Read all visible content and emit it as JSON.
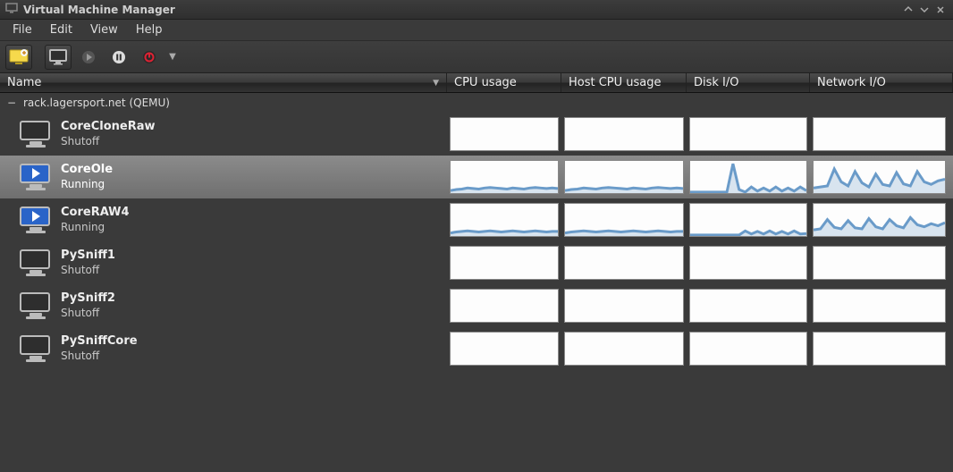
{
  "window": {
    "title": "Virtual Machine Manager"
  },
  "menu": {
    "file": "File",
    "edit": "Edit",
    "view": "View",
    "help": "Help"
  },
  "columns": {
    "name": "Name",
    "cpu": "CPU usage",
    "host": "Host CPU usage",
    "disk": "Disk I/O",
    "net": "Network I/O"
  },
  "host": {
    "label": "rack.lagersport.net (QEMU)"
  },
  "status": {
    "shutoff": "Shutoff",
    "running": "Running"
  },
  "vms": [
    {
      "name": "CoreCloneRaw",
      "status": "shutoff",
      "selected": false,
      "cpu": [
        0,
        0,
        0,
        0,
        0,
        0,
        0,
        0,
        0,
        0,
        0,
        0,
        0,
        0,
        0,
        0,
        0,
        0,
        0,
        0
      ],
      "hostcpu": [
        0,
        0,
        0,
        0,
        0,
        0,
        0,
        0,
        0,
        0,
        0,
        0,
        0,
        0,
        0,
        0,
        0,
        0,
        0,
        0
      ],
      "disk": [
        0,
        0,
        0,
        0,
        0,
        0,
        0,
        0,
        0,
        0,
        0,
        0,
        0,
        0,
        0,
        0,
        0,
        0,
        0,
        0
      ],
      "net": [
        0,
        0,
        0,
        0,
        0,
        0,
        0,
        0,
        0,
        0,
        0,
        0,
        0,
        0,
        0,
        0,
        0,
        0,
        0,
        0
      ]
    },
    {
      "name": "CoreOle",
      "status": "running",
      "selected": true,
      "cpu": [
        3,
        5,
        6,
        8,
        7,
        6,
        8,
        9,
        8,
        7,
        6,
        8,
        7,
        6,
        8,
        9,
        8,
        7,
        8,
        7
      ],
      "hostcpu": [
        3,
        5,
        6,
        8,
        7,
        6,
        8,
        9,
        8,
        7,
        6,
        8,
        7,
        6,
        8,
        9,
        8,
        7,
        8,
        7
      ],
      "disk": [
        0,
        0,
        0,
        0,
        0,
        0,
        0,
        55,
        5,
        0,
        10,
        2,
        8,
        2,
        10,
        2,
        8,
        2,
        10,
        3
      ],
      "net": [
        8,
        10,
        12,
        45,
        20,
        12,
        40,
        18,
        10,
        35,
        15,
        12,
        38,
        16,
        12,
        40,
        20,
        15,
        22,
        25
      ]
    },
    {
      "name": "CoreRAW4",
      "status": "running",
      "selected": false,
      "cpu": [
        4,
        6,
        7,
        8,
        7,
        6,
        7,
        8,
        7,
        6,
        7,
        8,
        7,
        6,
        7,
        8,
        7,
        6,
        7,
        7
      ],
      "hostcpu": [
        4,
        6,
        7,
        8,
        7,
        6,
        7,
        8,
        7,
        6,
        7,
        8,
        7,
        6,
        7,
        8,
        7,
        6,
        7,
        7
      ],
      "disk": [
        0,
        0,
        0,
        0,
        0,
        0,
        0,
        0,
        0,
        8,
        2,
        7,
        2,
        8,
        2,
        7,
        2,
        8,
        2,
        3
      ],
      "net": [
        10,
        12,
        30,
        15,
        12,
        28,
        14,
        12,
        32,
        16,
        12,
        30,
        18,
        14,
        34,
        20,
        16,
        22,
        18,
        24
      ]
    },
    {
      "name": "PySniff1",
      "status": "shutoff",
      "selected": false,
      "cpu": [
        0,
        0,
        0,
        0,
        0,
        0,
        0,
        0,
        0,
        0,
        0,
        0,
        0,
        0,
        0,
        0,
        0,
        0,
        0,
        0
      ],
      "hostcpu": [
        0,
        0,
        0,
        0,
        0,
        0,
        0,
        0,
        0,
        0,
        0,
        0,
        0,
        0,
        0,
        0,
        0,
        0,
        0,
        0
      ],
      "disk": [
        0,
        0,
        0,
        0,
        0,
        0,
        0,
        0,
        0,
        0,
        0,
        0,
        0,
        0,
        0,
        0,
        0,
        0,
        0,
        0
      ],
      "net": [
        0,
        0,
        0,
        0,
        0,
        0,
        0,
        0,
        0,
        0,
        0,
        0,
        0,
        0,
        0,
        0,
        0,
        0,
        0,
        0
      ]
    },
    {
      "name": "PySniff2",
      "status": "shutoff",
      "selected": false,
      "cpu": [
        0,
        0,
        0,
        0,
        0,
        0,
        0,
        0,
        0,
        0,
        0,
        0,
        0,
        0,
        0,
        0,
        0,
        0,
        0,
        0
      ],
      "hostcpu": [
        0,
        0,
        0,
        0,
        0,
        0,
        0,
        0,
        0,
        0,
        0,
        0,
        0,
        0,
        0,
        0,
        0,
        0,
        0,
        0
      ],
      "disk": [
        0,
        0,
        0,
        0,
        0,
        0,
        0,
        0,
        0,
        0,
        0,
        0,
        0,
        0,
        0,
        0,
        0,
        0,
        0,
        0
      ],
      "net": [
        0,
        0,
        0,
        0,
        0,
        0,
        0,
        0,
        0,
        0,
        0,
        0,
        0,
        0,
        0,
        0,
        0,
        0,
        0,
        0
      ]
    },
    {
      "name": "PySniffCore",
      "status": "shutoff",
      "selected": false,
      "cpu": [
        0,
        0,
        0,
        0,
        0,
        0,
        0,
        0,
        0,
        0,
        0,
        0,
        0,
        0,
        0,
        0,
        0,
        0,
        0,
        0
      ],
      "hostcpu": [
        0,
        0,
        0,
        0,
        0,
        0,
        0,
        0,
        0,
        0,
        0,
        0,
        0,
        0,
        0,
        0,
        0,
        0,
        0,
        0
      ],
      "disk": [
        0,
        0,
        0,
        0,
        0,
        0,
        0,
        0,
        0,
        0,
        0,
        0,
        0,
        0,
        0,
        0,
        0,
        0,
        0,
        0
      ],
      "net": [
        0,
        0,
        0,
        0,
        0,
        0,
        0,
        0,
        0,
        0,
        0,
        0,
        0,
        0,
        0,
        0,
        0,
        0,
        0,
        0
      ]
    }
  ],
  "colors": {
    "sparkline": "#6a9bc9"
  }
}
